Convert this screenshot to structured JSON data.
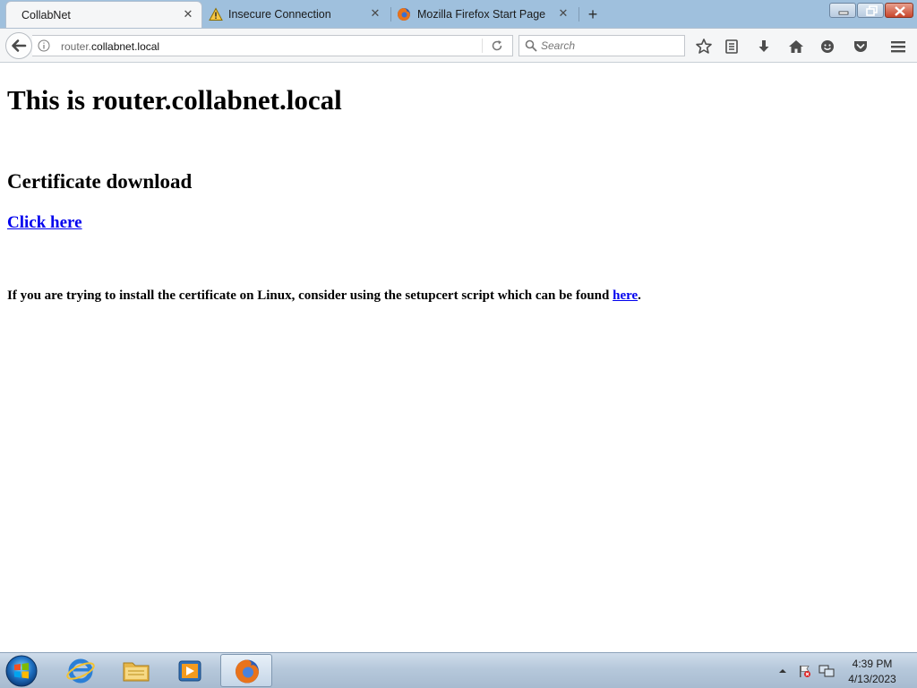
{
  "tabs": [
    {
      "label": "CollabNet",
      "active": true
    },
    {
      "label": "Insecure Connection",
      "active": false
    },
    {
      "label": "Mozilla Firefox Start Page",
      "active": false
    }
  ],
  "urlbar": {
    "prefix": "router.",
    "host": "collabnet.local"
  },
  "search": {
    "placeholder": "Search"
  },
  "page": {
    "title": "This is router.collabnet.local",
    "heading": "Certificate download",
    "link": "Click here",
    "note_text": "If you are trying to install the certificate on Linux, consider using the setupcert script which can be found ",
    "note_link": "here",
    "note_end": "."
  },
  "taskbar": {
    "time": "4:39 PM",
    "date": "4/13/2023"
  },
  "colors": {
    "link": "#0000ee",
    "tabstrip": "#9fc0dd",
    "taskbar": "#b6c8db"
  },
  "icons": [
    "info-icon",
    "reload-icon",
    "search-icon",
    "bookmark-star-icon",
    "reading-list-icon",
    "download-icon",
    "home-icon",
    "hello-icon",
    "pocket-icon",
    "menu-icon",
    "warning-icon",
    "firefox-icon"
  ]
}
